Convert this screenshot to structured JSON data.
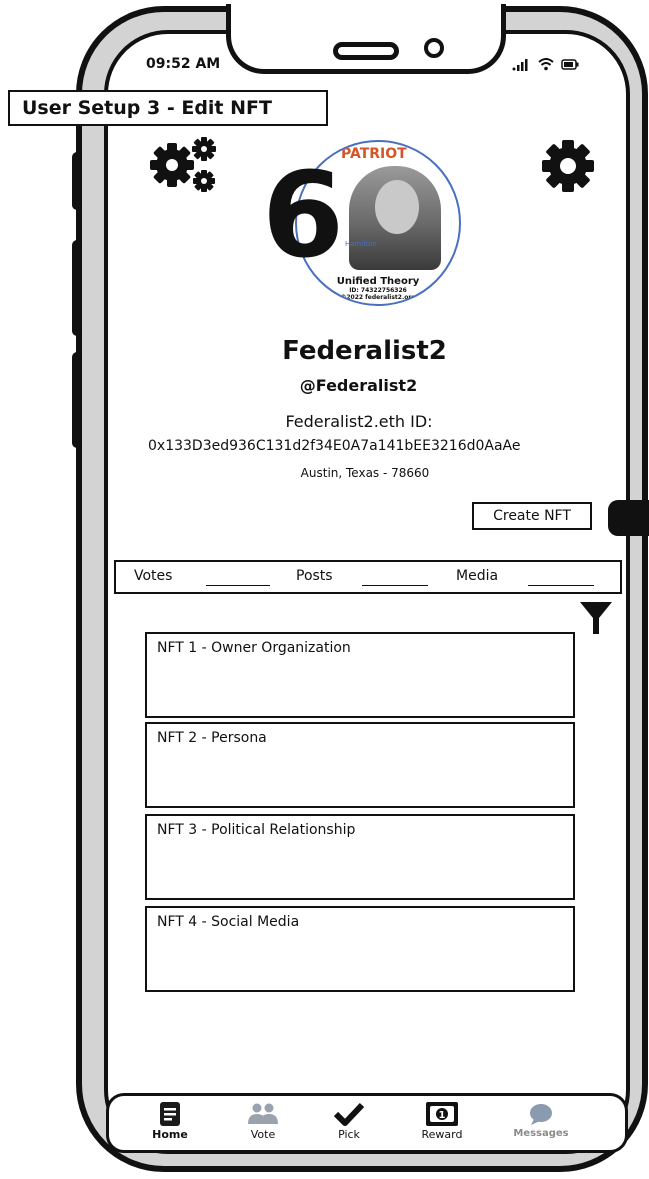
{
  "status_bar": {
    "time": "09:52 AM",
    "icons": ".ıl ≋ ▭"
  },
  "screen_title": "User Setup 3 - Edit NFT",
  "badge": {
    "top_text": "PATRIOT",
    "portrait_label": "Hamilton",
    "title": "Unified Theory",
    "id_line": "ID: 74322756326",
    "copyright": "©2022 federalist2.org"
  },
  "big_number": "6",
  "profile": {
    "name": "Federalist2",
    "handle": "@Federalist2",
    "eth_label": "Federalist2.eth ID:",
    "eth_address": "0x133D3ed936C131d2f34E0A7a141bEE3216d0AaAe",
    "location": "Austin, Texas - 78660"
  },
  "create_nft_label": "Create NFT",
  "stats": [
    {
      "label": "Votes"
    },
    {
      "label": "Posts"
    },
    {
      "label": "Media"
    }
  ],
  "nft_cards": [
    {
      "label": "NFT 1 - Owner Organization"
    },
    {
      "label": "NFT 2 - Persona"
    },
    {
      "label": "NFT 3 - Political Relationship"
    },
    {
      "label": "NFT 4 - Social Media"
    }
  ],
  "tabbar": [
    {
      "label": "Home",
      "icon": "document-icon",
      "color": "#1a1a1a"
    },
    {
      "label": "Vote",
      "icon": "people-icon",
      "color": "#1a1a1a"
    },
    {
      "label": "Pick",
      "icon": "checkmark-icon",
      "color": "#1a1a1a"
    },
    {
      "label": "Reward",
      "icon": "dollar-bill-icon",
      "color": "#1a1a1a"
    },
    {
      "label": "Messages",
      "icon": "chat-bubble-icon",
      "color": "#8a8a8a"
    }
  ],
  "colors": {
    "badge_border": "#4a6fbf",
    "badge_accent": "#d4552a",
    "phone_frame": "#d3d3d3",
    "inactive_icon": "#9aa3ad"
  }
}
